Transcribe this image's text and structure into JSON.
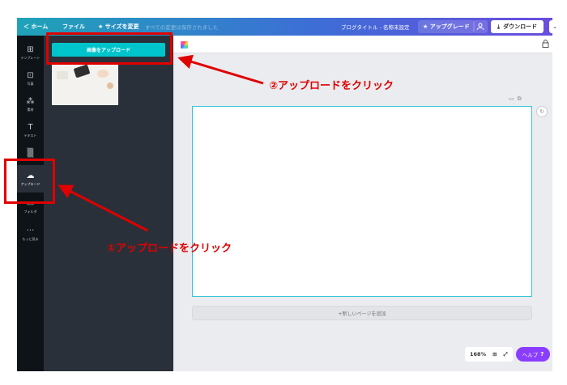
{
  "topbar": {
    "back_label": "＜ ホーム",
    "file_label": "ファイル",
    "resize_label": "★ サイズを変更",
    "saved_status": "すべての変更は保存されました",
    "design_title": "ブログタイトル - 名称未設定",
    "upgrade_label": "★ アップグレード",
    "download_label": "ダウンロード",
    "more_label": "⌄"
  },
  "sidebar": {
    "items": [
      {
        "label": "テンプレート",
        "icon": "template-icon",
        "glyph": "⊞"
      },
      {
        "label": "写真",
        "icon": "photo-icon",
        "glyph": "⊡"
      },
      {
        "label": "素材",
        "icon": "elements-icon",
        "glyph": "⁂"
      },
      {
        "label": "テキスト",
        "icon": "text-icon",
        "glyph": "T"
      },
      {
        "label": "",
        "icon": "background-icon",
        "glyph": "▒"
      },
      {
        "label": "アップロード",
        "icon": "upload-cloud-icon",
        "glyph": "☁"
      },
      {
        "label": "フォルダ",
        "icon": "folder-icon",
        "glyph": "▭"
      },
      {
        "label": "もっと見る",
        "icon": "more-icon",
        "glyph": "···"
      }
    ]
  },
  "panel": {
    "upload_button_label": "画像をアップロード"
  },
  "editor": {
    "add_page_label": "+新しいページを追加",
    "zoom_label": "168%"
  },
  "help": {
    "label": "ヘルプ",
    "q": "?"
  },
  "annotations": {
    "step2": "②アップロードをクリック",
    "step1": "①アップロードをクリック",
    "color": "#e00000"
  }
}
